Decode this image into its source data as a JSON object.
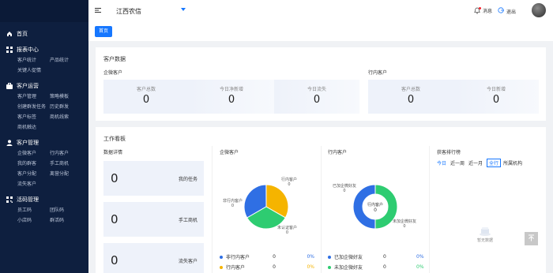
{
  "header": {
    "org_name": "江西农信",
    "messages_label": "消息",
    "logout_label": "退出"
  },
  "tabs": {
    "home_label": "首页"
  },
  "sidebar": {
    "home": "首页",
    "groups": [
      {
        "label": "报表中心",
        "items": [
          "客户统计",
          "产品统计",
          "关键人促情"
        ]
      },
      {
        "label": "客户运营",
        "items": [
          "客户管理",
          "策略模板",
          "创建群发任务",
          "历史群发",
          "客户标签",
          "商机线索",
          "商机触达"
        ]
      },
      {
        "label": "客户管理",
        "items": [
          "企微客户",
          "行内客户",
          "我的群客",
          "手工商机",
          "客户分配",
          "离营分配",
          "流失客户"
        ]
      },
      {
        "label": "活码管理",
        "items": [
          "员工码",
          "团队码",
          "小店码",
          "群活码"
        ]
      }
    ]
  },
  "customer_data": {
    "title": "客户数据",
    "wecom": {
      "title": "企微客户",
      "stats": [
        {
          "label": "客户总数",
          "value": "0"
        },
        {
          "label": "今日净新增",
          "value": "0"
        },
        {
          "label": "今日流失",
          "value": "0"
        }
      ]
    },
    "bank": {
      "title": "行内客户",
      "stats": [
        {
          "label": "客户总数",
          "value": "0"
        },
        {
          "label": "今日新增",
          "value": "0"
        }
      ]
    }
  },
  "workboard": {
    "title": "工作看板",
    "details_title": "数据详情",
    "details": [
      {
        "value": "0",
        "label": "我的任务"
      },
      {
        "value": "0",
        "label": "手工商机"
      },
      {
        "value": "0",
        "label": "流失客户"
      }
    ],
    "wecom_chart": {
      "title": "企微客户",
      "labels": [
        {
          "name": "行内客户",
          "value": "0"
        },
        {
          "name": "非行内客户",
          "value": "0"
        },
        {
          "name": "未认证客户",
          "value": "0"
        }
      ],
      "legend": [
        {
          "name": "非行内客户",
          "value": "0",
          "pct": "0%",
          "color": "#2f6fe4"
        },
        {
          "name": "行内客户",
          "value": "0",
          "pct": "0%",
          "color": "#f5b400"
        }
      ],
      "slices": [
        {
          "color": "#2f6fe4",
          "share": 0.333
        },
        {
          "color": "#f5b400",
          "share": 0.333
        },
        {
          "color": "#2ecc71",
          "share": 0.334
        }
      ]
    },
    "bank_chart": {
      "title": "行内客户",
      "center_label": "行内客户",
      "center_value": "0",
      "labels": [
        {
          "name": "已加企微好友",
          "value": "0"
        },
        {
          "name": "未加企微好友",
          "value": "0"
        }
      ],
      "legend": [
        {
          "name": "已加企微好友",
          "value": "0",
          "pct": "0%",
          "color": "#2f6fe4"
        },
        {
          "name": "未加企微好友",
          "value": "0",
          "pct": "0%",
          "color": "#2ecc71"
        }
      ],
      "slices": [
        {
          "color": "#2f6fe4",
          "share": 0.5
        },
        {
          "color": "#2ecc71",
          "share": 0.5
        }
      ]
    },
    "ranking": {
      "title": "获客排行榜",
      "filters": [
        "今日",
        "近一周",
        "近一月",
        "全行",
        "所属机构"
      ],
      "empty_text": "暂无数据"
    }
  }
}
